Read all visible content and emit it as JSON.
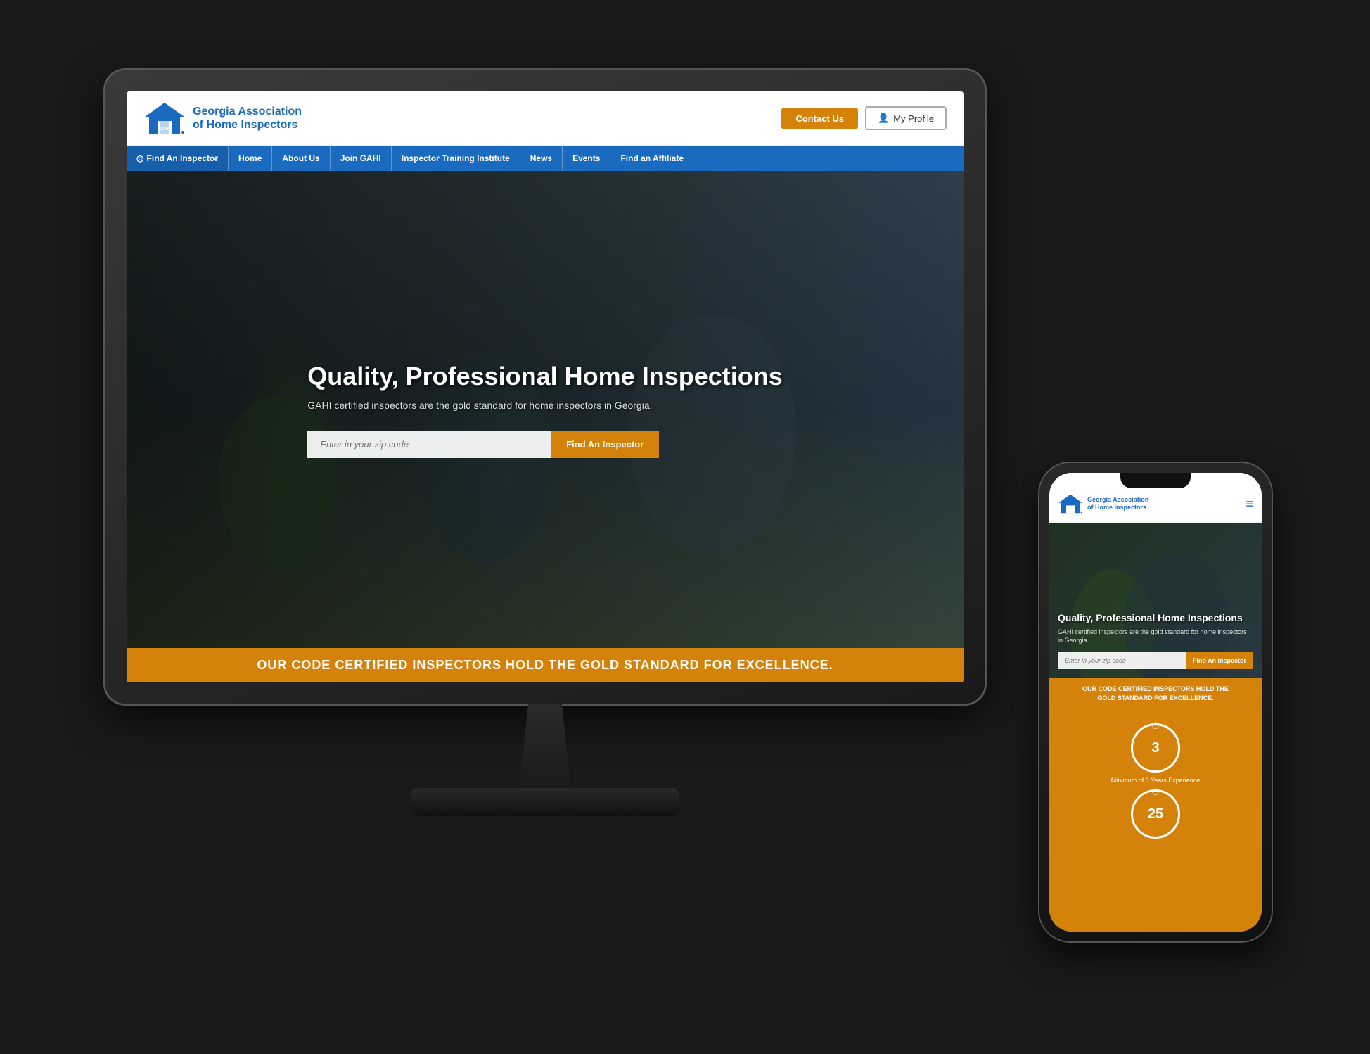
{
  "monitor": {
    "header": {
      "logo_title_line1": "Georgia Association",
      "logo_title_line2": "of Home Inspectors",
      "logo_abbr": "GAHI",
      "contact_btn": "Contact Us",
      "profile_btn": "My Profile"
    },
    "nav": {
      "items": [
        {
          "label": "Find An Inspector",
          "has_icon": true
        },
        {
          "label": "Home"
        },
        {
          "label": "About Us"
        },
        {
          "label": "Join GAHI"
        },
        {
          "label": "Inspector Training Institute"
        },
        {
          "label": "News"
        },
        {
          "label": "Events"
        },
        {
          "label": "Find an Affiliate"
        }
      ]
    },
    "hero": {
      "title": "Quality, Professional Home Inspections",
      "subtitle": "GAHI certified inspectors are the gold standard for home inspectors in Georgia.",
      "zip_placeholder": "Enter in your zip code",
      "find_btn": "Find An Inspector",
      "banner_text": "OUR CODE CERTIFIED INSPECTORS HOLD THE GOLD STANDARD FOR EXCELLENCE."
    }
  },
  "phone": {
    "header": {
      "logo_title_line1": "Georgia Association",
      "logo_title_line2": "of Home Inspectors",
      "logo_abbr": "GAHI"
    },
    "hero": {
      "title": "Quality, Professional Home Inspections",
      "subtitle": "GAHI certified inspectors are the gold standard for home inspectors in Georgia.",
      "zip_placeholder": "Enter in your zip code",
      "find_btn": "Find An Inspector"
    },
    "gold_banner": {
      "line1": "OUR CODE CERTIFIED INSPECTORS HOLD THE",
      "line2": "GOLD STANDARD FOR EXCELLENCE."
    },
    "stats": {
      "item1": {
        "number": "3",
        "label": "Minimum of 3 Years Experience"
      },
      "item2": {
        "number": "25"
      }
    }
  },
  "colors": {
    "brand_blue": "#1a6abf",
    "brand_orange": "#d4820a",
    "white": "#ffffff",
    "dark": "#111111"
  }
}
